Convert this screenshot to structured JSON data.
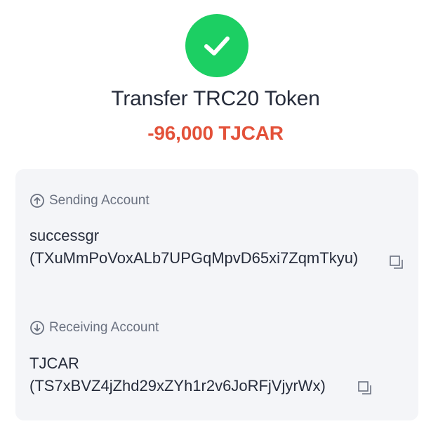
{
  "status": {
    "icon": "check-circle-icon",
    "color": "#1ccf63"
  },
  "title": "Transfer TRC20 Token",
  "amount": {
    "value": "-96,000 TJCAR",
    "color": "#e35139"
  },
  "sending": {
    "label": "Sending Account",
    "icon": "arrow-up-circle-icon",
    "name": "successgr",
    "address": "(TXuMmPoVoxALb7UPGqMpvD65xi7ZqmTkyu)",
    "copy_icon": "copy-icon"
  },
  "receiving": {
    "label": "Receiving Account",
    "icon": "arrow-down-circle-icon",
    "name": "TJCAR",
    "address": "(TS7xBVZ4jZhd29xZYh1r2v6JoRFjVjyrWx)",
    "copy_icon": "copy-icon"
  }
}
